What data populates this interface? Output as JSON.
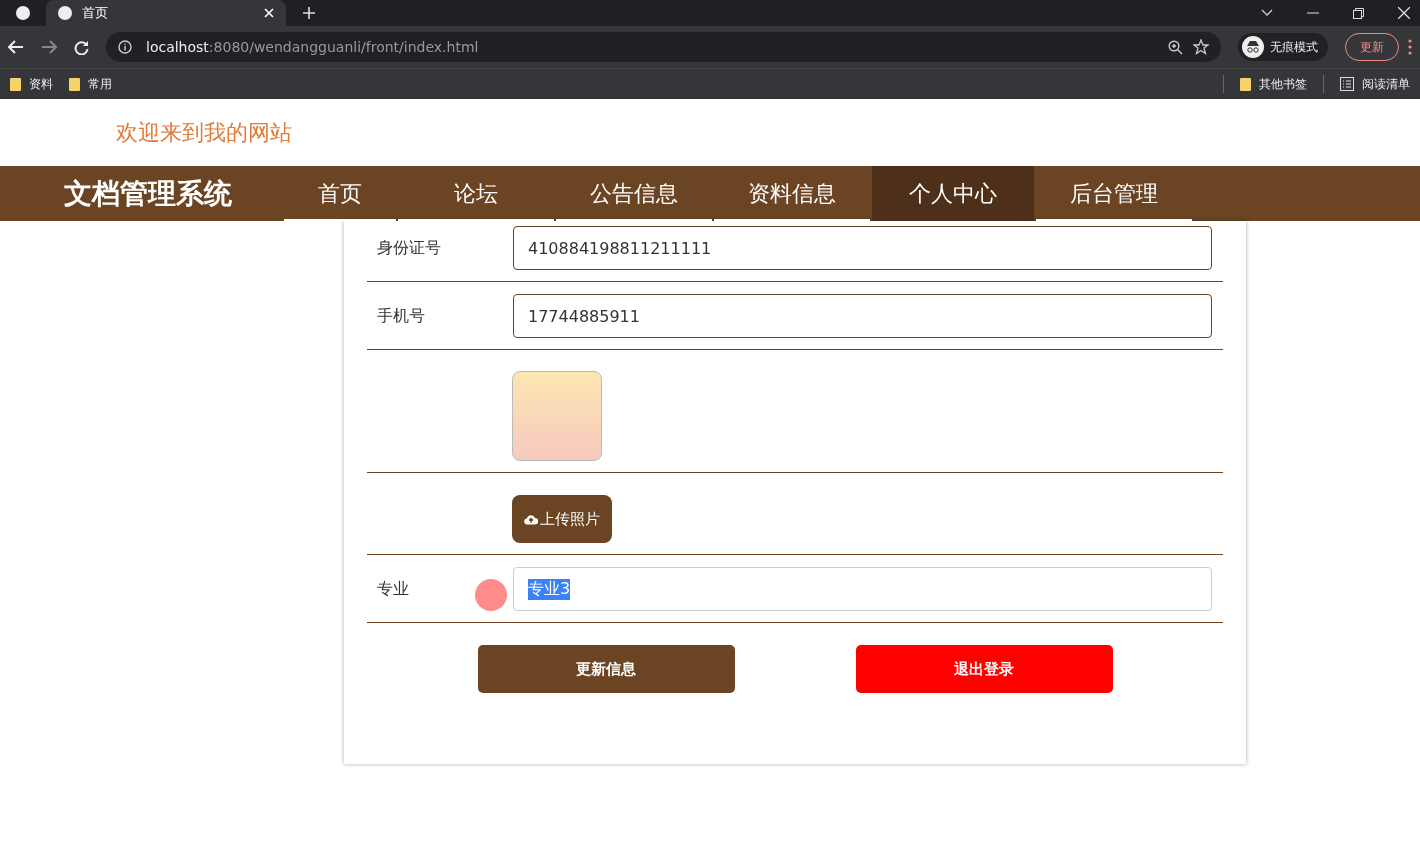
{
  "browser": {
    "tabs": [
      {
        "label": "首页",
        "selected": true
      }
    ],
    "url_host": "localhost",
    "url_path": ":8080/wendangguanli/front/index.html",
    "profile": "无痕模式",
    "update_button": "更新",
    "bookmarks": [
      "资料",
      "常用"
    ],
    "bookmarks_right": [
      {
        "label": "其他书签",
        "kind": "folder"
      },
      {
        "label": "阅读清单",
        "kind": "list"
      }
    ]
  },
  "page": {
    "welcome": "欢迎来到我的网站",
    "site_title": "文档管理系统",
    "nav": [
      {
        "label": "首页",
        "selected": false
      },
      {
        "label": "论坛",
        "selected": false
      },
      {
        "label": "公告信息",
        "selected": false
      },
      {
        "label": "资料信息",
        "selected": false
      },
      {
        "label": "个人中心",
        "selected": true
      },
      {
        "label": "后台管理",
        "selected": false
      }
    ],
    "form_rows": [
      {
        "kind": "field",
        "label": "身份证号",
        "value": "410884198811211111",
        "text_selected": false
      },
      {
        "kind": "field",
        "label": "手机号",
        "value": "17744885911",
        "text_selected": false
      },
      {
        "kind": "image"
      },
      {
        "kind": "upload",
        "button": "上传照片"
      },
      {
        "kind": "field",
        "label": "专业",
        "value": "专业3",
        "text_selected": true
      }
    ],
    "buttons": [
      {
        "label": "更新信息",
        "kind": "primary"
      },
      {
        "label": "退出登录",
        "kind": "danger"
      }
    ]
  }
}
